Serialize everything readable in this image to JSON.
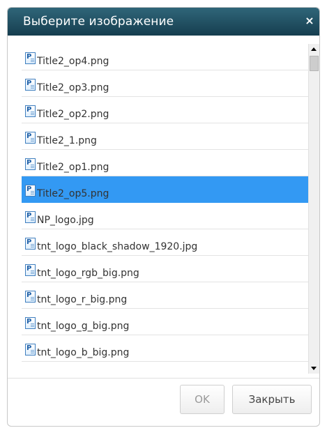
{
  "dialog": {
    "title": "Выберите изображение",
    "close_icon": "×"
  },
  "files": {
    "icon": "P",
    "selected_index": 5,
    "items": [
      {
        "name": "Title2_op4.png"
      },
      {
        "name": "Title2_op3.png"
      },
      {
        "name": "Title2_op2.png"
      },
      {
        "name": "Title2_1.png"
      },
      {
        "name": "Title2_op1.png"
      },
      {
        "name": "Title2_op5.png"
      },
      {
        "name": "NP_logo.jpg"
      },
      {
        "name": "tnt_logo_black_shadow_1920.jpg"
      },
      {
        "name": "tnt_logo_rgb_big.png"
      },
      {
        "name": "tnt_logo_r_big.png"
      },
      {
        "name": "tnt_logo_g_big.png"
      },
      {
        "name": "tnt_logo_b_big.png"
      }
    ]
  },
  "buttons": {
    "ok_label": "OK",
    "close_label": "Закрыть"
  },
  "colors": {
    "titlebar": "#1f4c5e",
    "selection": "#3399f3"
  }
}
